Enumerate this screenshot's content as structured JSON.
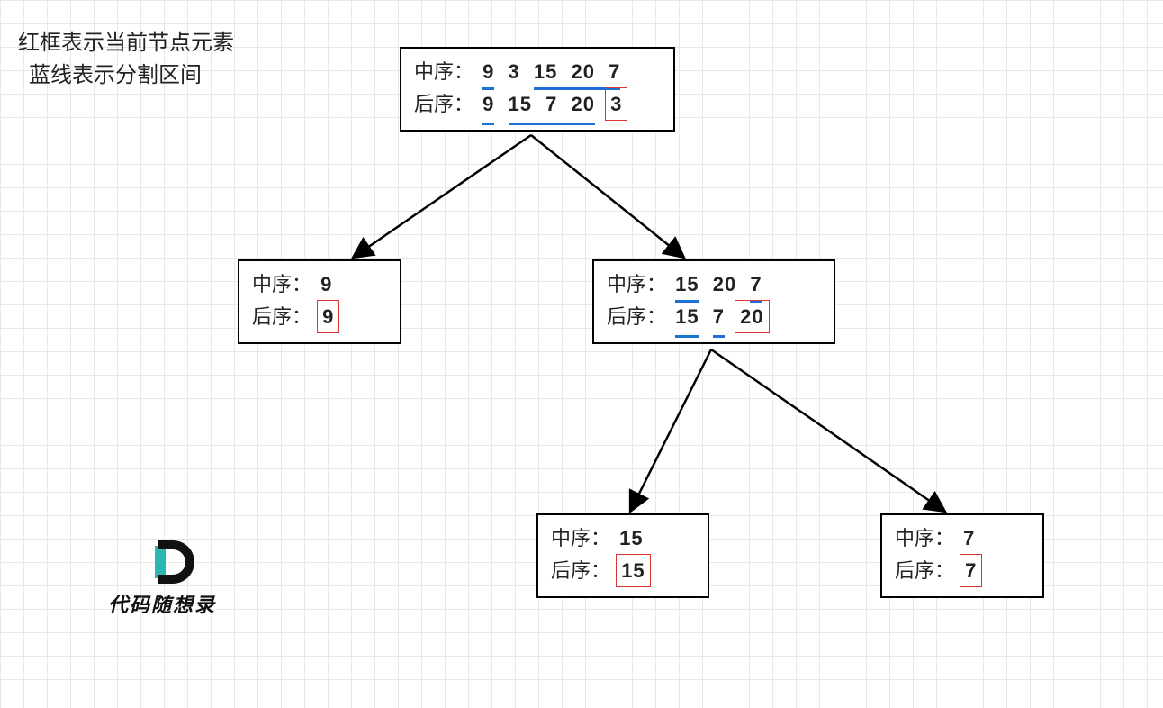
{
  "legend": {
    "line1": "红框表示当前节点元素",
    "line2": "蓝线表示分割区间"
  },
  "labels": {
    "inorder": "中序：",
    "postorder": "后序："
  },
  "nodes": {
    "root": {
      "inorder": [
        {
          "v": "9"
        },
        {
          "v": "3"
        },
        {
          "v": "15"
        },
        {
          "v": "20"
        },
        {
          "v": "7"
        }
      ],
      "postorder": [
        {
          "v": "9"
        },
        {
          "v": "15"
        },
        {
          "v": "7"
        },
        {
          "v": "20"
        },
        {
          "v": "3",
          "red": true
        }
      ],
      "in_groups": [
        [
          0,
          0
        ],
        [
          2,
          4
        ]
      ],
      "post_groups": [
        [
          0,
          0
        ],
        [
          1,
          3
        ]
      ]
    },
    "left": {
      "inorder": [
        {
          "v": "9"
        }
      ],
      "postorder": [
        {
          "v": "9",
          "red": true
        }
      ]
    },
    "right": {
      "inorder": [
        {
          "v": "15"
        },
        {
          "v": "20"
        },
        {
          "v": "7"
        }
      ],
      "postorder": [
        {
          "v": "15"
        },
        {
          "v": "7"
        },
        {
          "v": "20",
          "red": true
        }
      ],
      "in_groups": [
        [
          0,
          0
        ],
        [
          2,
          2
        ]
      ],
      "post_groups": [
        [
          0,
          0
        ],
        [
          1,
          1
        ]
      ]
    },
    "right_left": {
      "inorder": [
        {
          "v": "15"
        }
      ],
      "postorder": [
        {
          "v": "15",
          "red": true
        }
      ]
    },
    "right_right": {
      "inorder": [
        {
          "v": "7"
        }
      ],
      "postorder": [
        {
          "v": "7",
          "red": true
        }
      ]
    }
  },
  "watermark": "代码随想录"
}
